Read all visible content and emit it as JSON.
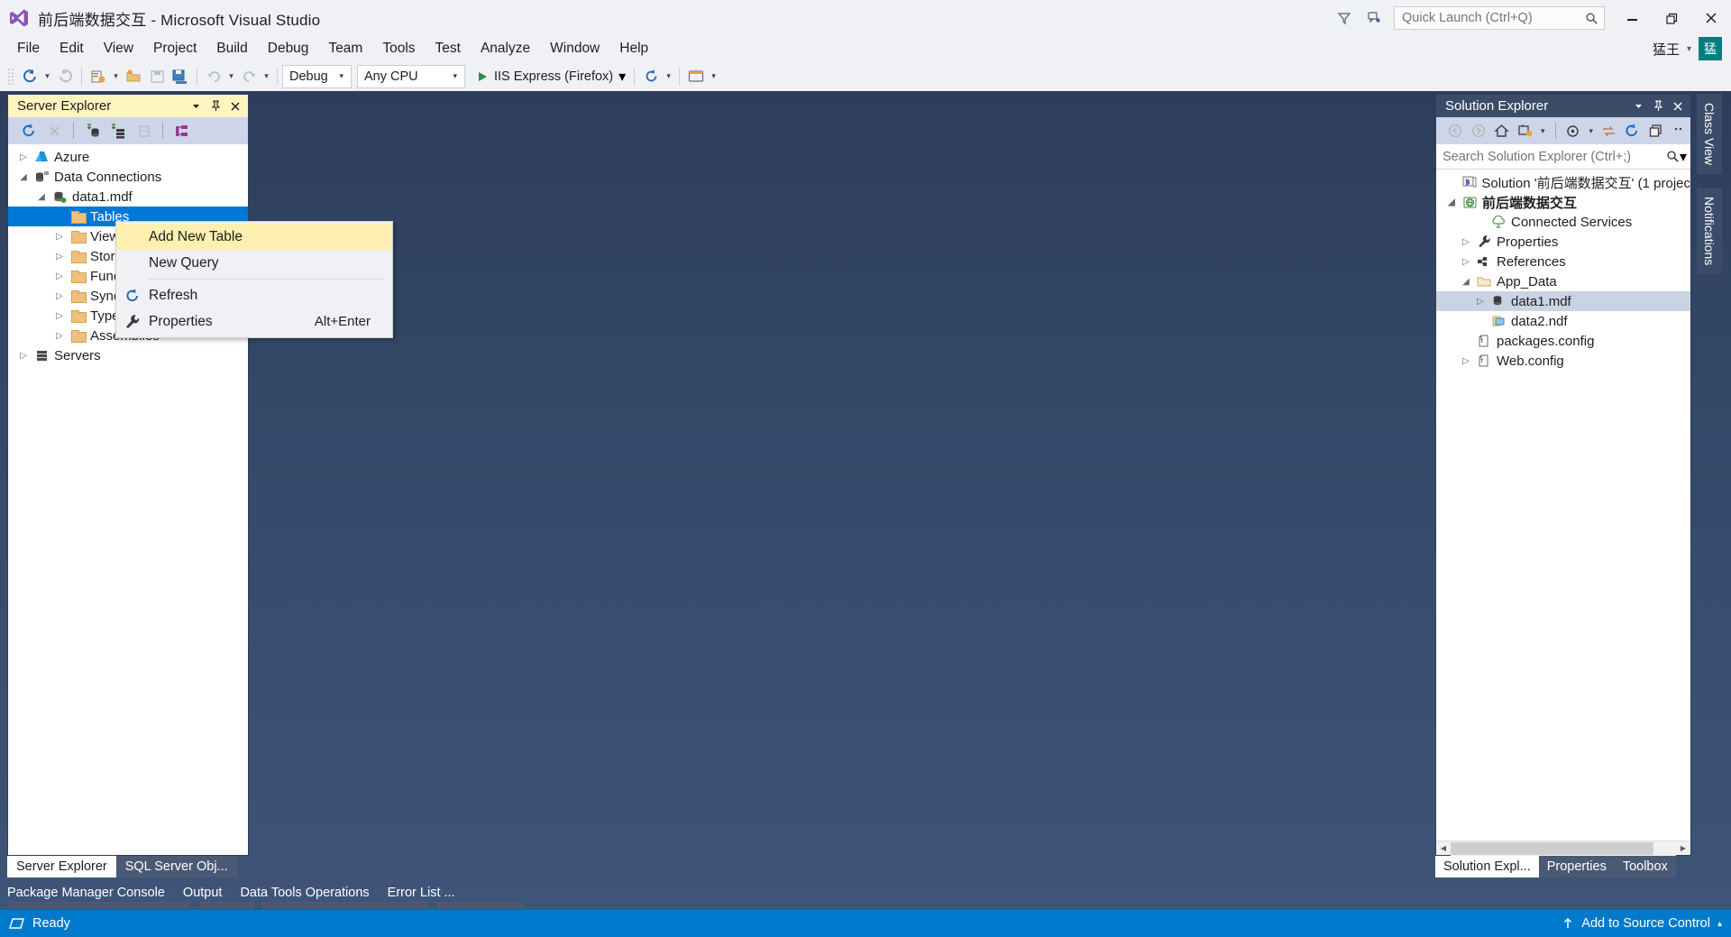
{
  "window": {
    "title": "前后端数据交互 - Microsoft Visual Studio",
    "logo_icon": "visual-studio-logo",
    "minimize_icon": "minimize-icon",
    "restore_icon": "restore-icon",
    "close_icon": "close-icon",
    "feedback_icon": "feedback-icon",
    "filter_icon": "filter-icon"
  },
  "quick_launch": {
    "placeholder": "Quick Launch (Ctrl+Q)",
    "value": "",
    "icon": "search-icon"
  },
  "account": {
    "name": "猛王",
    "avatar_text": "猛",
    "caret": "▾"
  },
  "menubar": {
    "items": [
      {
        "label": "File"
      },
      {
        "label": "Edit"
      },
      {
        "label": "View"
      },
      {
        "label": "Project"
      },
      {
        "label": "Build"
      },
      {
        "label": "Debug"
      },
      {
        "label": "Team"
      },
      {
        "label": "Tools"
      },
      {
        "label": "Test"
      },
      {
        "label": "Analyze"
      },
      {
        "label": "Window"
      },
      {
        "label": "Help"
      }
    ]
  },
  "toolbar": {
    "nav_back_icon": "navigate-back-icon",
    "nav_forward_icon": "navigate-forward-icon",
    "new_project_icon": "new-project-icon",
    "open_file_icon": "open-file-icon",
    "save_icon": "save-icon",
    "save_all_icon": "save-all-icon",
    "undo_icon": "undo-icon",
    "redo_icon": "redo-icon",
    "config_combo": {
      "value": "Debug",
      "caret": "▾"
    },
    "platform_combo": {
      "value": "Any CPU",
      "caret": "▾"
    },
    "run_label": "IIS Express (Firefox)",
    "run_icon": "play-icon",
    "run_caret": "▾",
    "refresh_icon": "refresh-icon",
    "refresh_caret": "▾",
    "preview_icon": "browser-preview-icon",
    "overflow_caret": "▾"
  },
  "server_explorer": {
    "title": "Server Explorer",
    "header_buttons": [
      {
        "icon": "chevron-down-icon",
        "glyph": "▾"
      },
      {
        "icon": "pin-icon",
        "glyph": "⚲"
      },
      {
        "icon": "close-icon",
        "glyph": "✕"
      }
    ],
    "toolbar_icons": [
      "refresh-icon",
      "stop-icon",
      "connect-to-database-icon",
      "connect-to-server-icon",
      "add-server-icon",
      "object-hierarchy-icon"
    ],
    "tree": [
      {
        "label": "Azure",
        "indent": 0,
        "twist": "▷",
        "icon": "azure-icon",
        "selected": false
      },
      {
        "label": "Data Connections",
        "indent": 0,
        "twist": "◢",
        "icon": "data-connections-icon",
        "selected": false
      },
      {
        "label": "data1.mdf",
        "indent": 1,
        "twist": "◢",
        "icon": "database-icon",
        "selected": false
      },
      {
        "label": "Tables",
        "indent": 2,
        "twist": "",
        "icon": "folder-icon",
        "selected": true
      },
      {
        "label": "Views",
        "indent": 2,
        "twist": "▷",
        "icon": "folder-icon",
        "selected": false
      },
      {
        "label": "Stored Procedures",
        "indent": 2,
        "twist": "▷",
        "icon": "folder-icon",
        "selected": false
      },
      {
        "label": "Functions",
        "indent": 2,
        "twist": "▷",
        "icon": "folder-icon",
        "selected": false
      },
      {
        "label": "Synonyms",
        "indent": 2,
        "twist": "▷",
        "icon": "folder-icon",
        "selected": false
      },
      {
        "label": "Types",
        "indent": 2,
        "twist": "▷",
        "icon": "folder-icon",
        "selected": false
      },
      {
        "label": "Assemblies",
        "indent": 2,
        "twist": "▷",
        "icon": "folder-icon",
        "selected": false
      },
      {
        "label": "Servers",
        "indent": 0,
        "twist": "▷",
        "icon": "servers-icon",
        "selected": false
      }
    ],
    "tabs": [
      {
        "label": "Server Explorer",
        "active": true
      },
      {
        "label": "SQL Server Obj...",
        "active": false
      }
    ]
  },
  "context_menu": {
    "items": [
      {
        "label": "Add New Table",
        "shortcut": "",
        "icon": "",
        "highlighted": true,
        "separator_after": false
      },
      {
        "label": "New Query",
        "shortcut": "",
        "icon": "",
        "highlighted": false,
        "separator_after": true
      },
      {
        "label": "Refresh",
        "shortcut": "",
        "icon": "refresh-icon",
        "highlighted": false,
        "separator_after": false
      },
      {
        "label": "Properties",
        "shortcut": "Alt+Enter",
        "icon": "wrench-icon",
        "highlighted": false,
        "separator_after": false
      }
    ]
  },
  "solution_explorer": {
    "title": "Solution Explorer",
    "header_buttons": [
      {
        "icon": "chevron-down-icon",
        "glyph": "▾"
      },
      {
        "icon": "pin-icon",
        "glyph": "⚲"
      },
      {
        "icon": "close-icon",
        "glyph": "✕"
      }
    ],
    "toolbar_icons": [
      "back-icon",
      "forward-icon",
      "home-icon",
      "pending-changes-icon",
      "show-all-files-icon",
      "sync-icon",
      "refresh-icon",
      "collapse-all-icon",
      "overflow-icon"
    ],
    "search": {
      "placeholder": "Search Solution Explorer (Ctrl+;)",
      "value": "",
      "icon": "search-icon",
      "caret": "▾"
    },
    "tree": [
      {
        "label": "Solution '前后端数据交互' (1 projec",
        "indent": 0,
        "twist": "",
        "icon": "solution-icon",
        "bold": false,
        "selected": false
      },
      {
        "label": "前后端数据交互",
        "indent": 0,
        "twist": "◢",
        "icon": "web-project-icon",
        "bold": true,
        "selected": false
      },
      {
        "label": "Connected Services",
        "indent": 1,
        "twist": "",
        "icon": "connected-services-icon",
        "bold": false,
        "selected": false
      },
      {
        "label": "Properties",
        "indent": 1,
        "twist": "▷",
        "icon": "wrench-icon",
        "bold": false,
        "selected": false
      },
      {
        "label": "References",
        "indent": 1,
        "twist": "▷",
        "icon": "references-icon",
        "bold": false,
        "selected": false
      },
      {
        "label": "App_Data",
        "indent": 1,
        "twist": "◢",
        "icon": "folder-open-icon",
        "bold": false,
        "selected": false
      },
      {
        "label": "data1.mdf",
        "indent": 2,
        "twist": "▷",
        "icon": "database-icon",
        "bold": false,
        "selected": true
      },
      {
        "label": "data2.ndf",
        "indent": 2,
        "twist": "",
        "icon": "file-icon",
        "bold": false,
        "selected": false
      },
      {
        "label": "packages.config",
        "indent": 1,
        "twist": "",
        "icon": "config-file-icon",
        "bold": false,
        "selected": false
      },
      {
        "label": "Web.config",
        "indent": 1,
        "twist": "▷",
        "icon": "config-file-icon",
        "bold": false,
        "selected": false
      }
    ],
    "tabs": [
      {
        "label": "Solution Expl...",
        "active": true
      },
      {
        "label": "Properties",
        "active": false
      },
      {
        "label": "Toolbox",
        "active": false
      }
    ]
  },
  "right_vertical_tabs": [
    {
      "label": "Class View"
    },
    {
      "label": "Notifications"
    }
  ],
  "bottom_dock_tabs": [
    {
      "label": "Package Manager Console"
    },
    {
      "label": "Output"
    },
    {
      "label": "Data Tools Operations"
    },
    {
      "label": "Error List ..."
    }
  ],
  "statusbar": {
    "status_icon": "status-ready-icon",
    "status_text": "Ready",
    "source_control_icon": "up-arrow-icon",
    "source_control_text": "Add to Source Control",
    "source_control_caret": "▴"
  }
}
